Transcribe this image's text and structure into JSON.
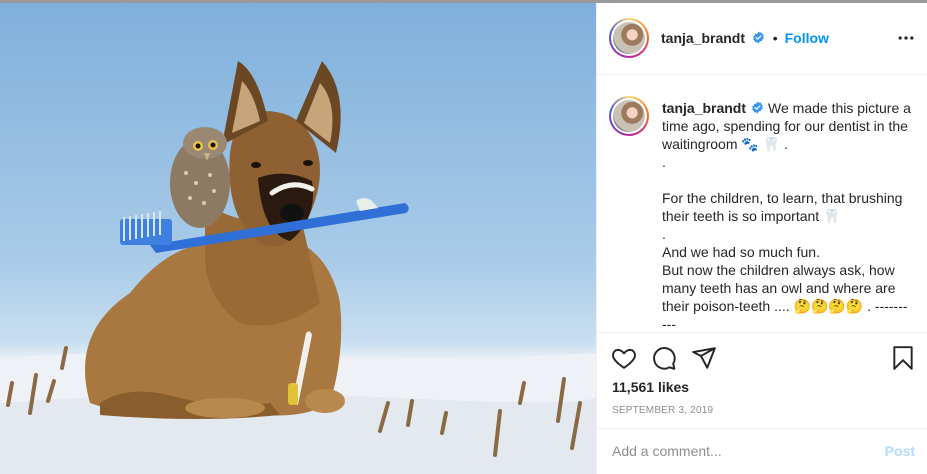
{
  "post": {
    "username": "tanja_brandt",
    "follow_label": "Follow",
    "dot": "•",
    "caption_lines": [
      "We made this picture a time ago, spending for our dentist in the waitingroom 🐾 🦷 .",
      ".",
      "",
      "For the children, to learn, that brushing their teeth is so important 🦷",
      ".",
      "And we had so much fun.",
      "But now the children always ask, how many teeth has an owl and where are their poison-teeth .... 🤔🤔🤔🤔 . ----------",
      "----------"
    ],
    "likes": "11,561 likes",
    "date": "SEPTEMBER 3, 2019",
    "comment_placeholder": "Add a comment...",
    "post_label": "Post"
  },
  "colors": {
    "follow": "#0095f6",
    "verified": "#3897f0",
    "post_disabled": "#b3dbff",
    "muted": "#8e8e8e"
  },
  "icons": {
    "more": "more-options-icon",
    "like": "heart-icon",
    "comment": "comment-icon",
    "share": "share-icon",
    "save": "bookmark-icon",
    "verified": "verified-badge-icon"
  }
}
